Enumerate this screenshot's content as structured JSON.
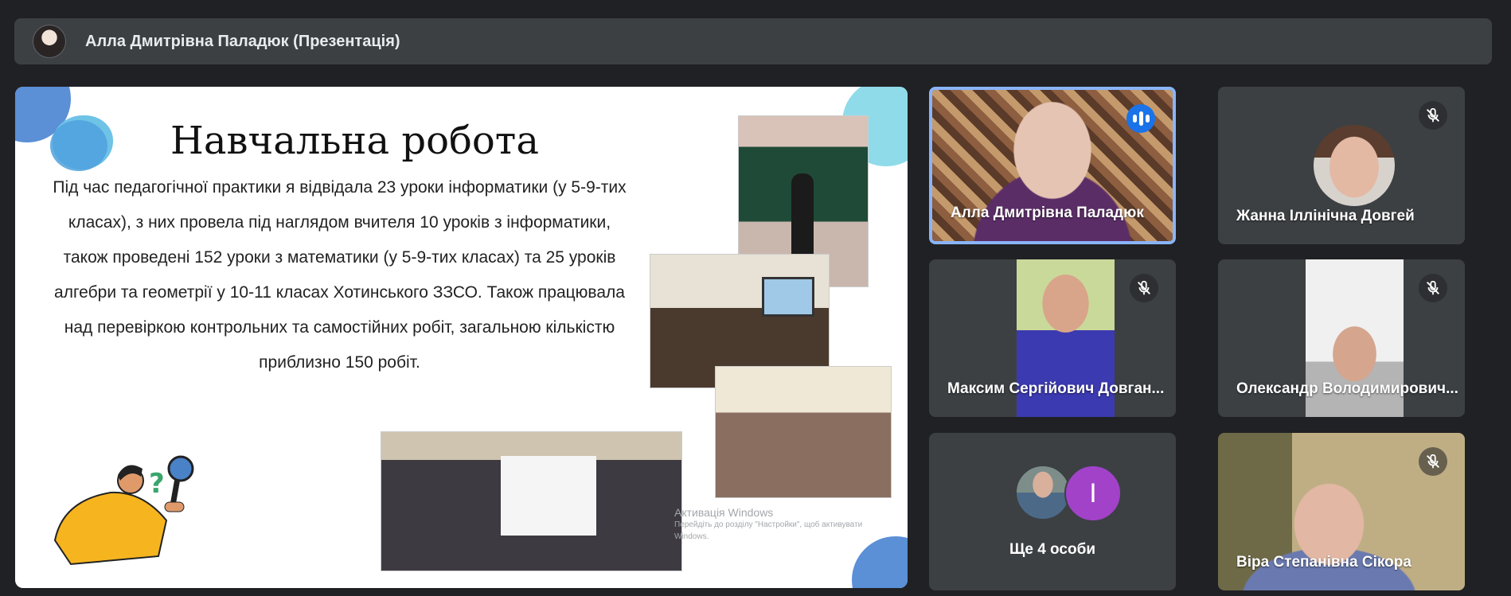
{
  "presenter_bar": {
    "title": "Алла Дмитрівна Паладюк (Презентація)"
  },
  "slide": {
    "title": "Навчальна робота",
    "body": "Під час педагогічної практики я відвідала 23 уроки інформатики (у 5-9-тих класах), з них провела під наглядом вчителя 10 уроків з інформатики, також проведені 152 уроки з математики (у 5-9-тих класах) та 25 уроків алгебри та геометрії у 10-11 класах Хотинського ЗЗСО. Також працювала над перевіркою контрольних та самостійних робіт, загальною кількістю приблизно 150 робіт.",
    "windows_activation": {
      "title": "Активація Windows",
      "subtitle": "Перейдіть до розділу \"Настройки\", щоб активувати Windows."
    }
  },
  "participants": [
    {
      "name": "Алла Дмитрівна Паладюк",
      "state": "speaking",
      "icon": "audio-level-icon"
    },
    {
      "name": "Жанна Іллінічна Довгей",
      "state": "muted",
      "icon": "mic-off-icon"
    },
    {
      "name": "Максим Сергійович Довган...",
      "state": "muted",
      "icon": "mic-off-icon"
    },
    {
      "name": "Олександр Володимирович...",
      "state": "muted",
      "icon": "mic-off-icon"
    },
    {
      "name": "Віра Степанівна Сікора",
      "state": "muted",
      "icon": "mic-off-icon"
    }
  ],
  "more_tile": {
    "label": "Ще 4 особи",
    "avatar_initial": "I"
  },
  "colors": {
    "background": "#202124",
    "tile": "#3c4043",
    "active_speaker_border": "#8ab4f8",
    "speaking_badge": "#1a73e8",
    "initial_avatar": "#a142c9"
  }
}
